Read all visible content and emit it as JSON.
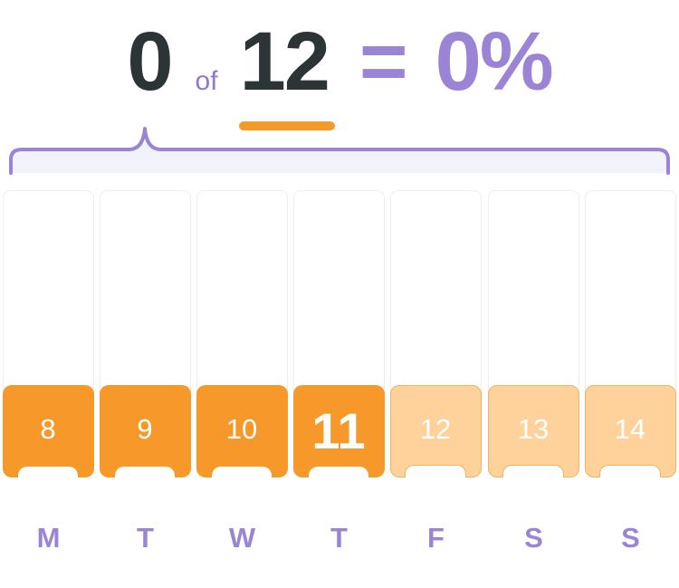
{
  "progress": {
    "completed": "0",
    "of_label": "of",
    "goal": "12",
    "equals": "=",
    "percent": "0%"
  },
  "colors": {
    "accent_purple": "#9b84d6",
    "accent_orange": "#f6992a",
    "future_orange": "#ffd19b"
  },
  "days": [
    {
      "date": "8",
      "weekday": "M",
      "state": "past"
    },
    {
      "date": "9",
      "weekday": "T",
      "state": "past"
    },
    {
      "date": "10",
      "weekday": "W",
      "state": "past"
    },
    {
      "date": "11",
      "weekday": "T",
      "state": "today"
    },
    {
      "date": "12",
      "weekday": "F",
      "state": "future"
    },
    {
      "date": "13",
      "weekday": "S",
      "state": "future"
    },
    {
      "date": "14",
      "weekday": "S",
      "state": "future"
    }
  ]
}
